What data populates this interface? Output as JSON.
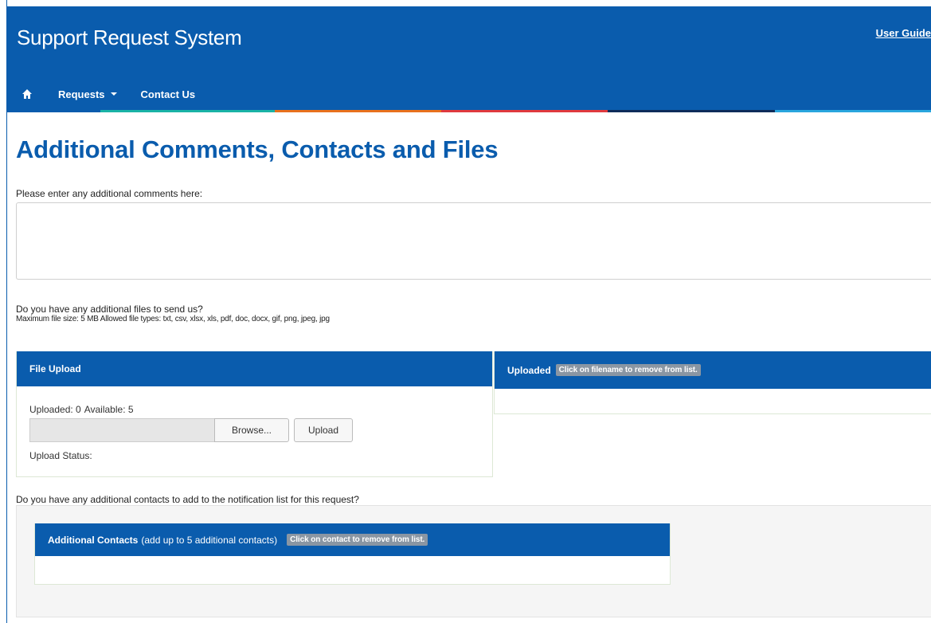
{
  "header": {
    "app_title": "Support Request System",
    "user_guide_label": "User Guide",
    "background_color": "#0a5cad",
    "stripe_colors": [
      "#0a5cad",
      "#1ab3a6",
      "#e8711d",
      "#e03a3e",
      "#0f2c5a",
      "#2aa6de"
    ]
  },
  "nav": {
    "home_icon": "home-icon",
    "items": [
      {
        "label": "Requests",
        "has_dropdown": true
      },
      {
        "label": "Contact Us",
        "has_dropdown": false
      }
    ]
  },
  "page": {
    "title": "Additional Comments, Contacts and Files",
    "comments_prompt": "Please enter any additional comments here:",
    "comments_value": ""
  },
  "files": {
    "prompt": "Do you have any additional files to send us?",
    "limits": "Maximum file size: 5 MB Allowed file types: txt, csv, xlsx, xls, pdf, doc, docx, gif, png, jpeg, jpg",
    "upload_panel": {
      "title": "File Upload",
      "uploaded_count": "Uploaded: 0",
      "available_count": "Available: 5",
      "browse_label": "Browse...",
      "upload_label": "Upload",
      "status_label": "Upload Status:"
    },
    "uploaded_panel": {
      "title": "Uploaded",
      "hint": "Click on filename to remove from list."
    }
  },
  "contacts": {
    "prompt": "Do you have any additional contacts to add to the notification list for this request?",
    "panel_title": "Additional Contacts",
    "panel_subtitle": "(add up to 5 additional contacts)",
    "hint": "Click on contact to remove from list."
  }
}
